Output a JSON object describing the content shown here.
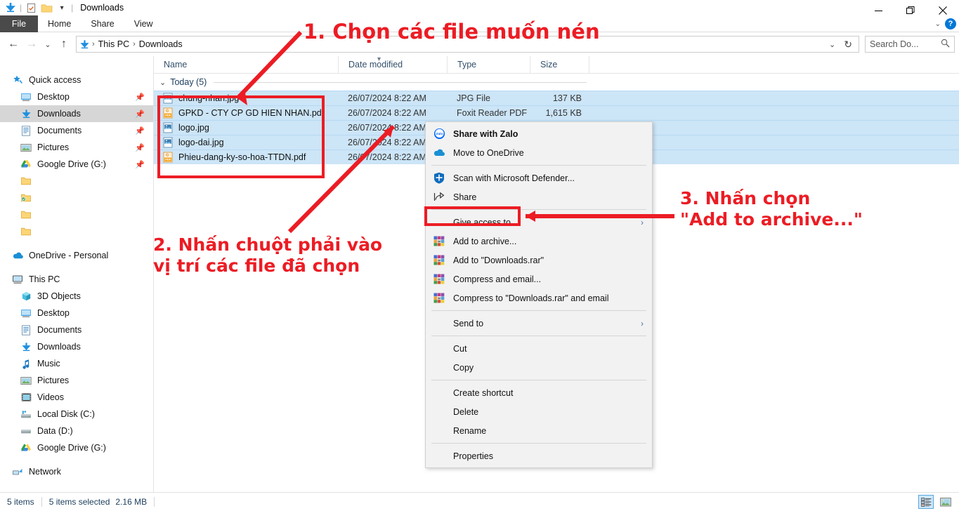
{
  "window": {
    "title": "Downloads",
    "quick_access_icons": [
      "downloads-arrow-icon",
      "properties-icon",
      "folder-icon",
      "chevron-down-icon"
    ],
    "minimize": "—",
    "maximize": "❐",
    "close": "✕"
  },
  "ribbon": {
    "tabs": [
      {
        "label": "File",
        "active": true
      },
      {
        "label": "Home",
        "active": false
      },
      {
        "label": "Share",
        "active": false
      },
      {
        "label": "View",
        "active": false
      }
    ],
    "collapse_chevron": "⌄",
    "help_label": "?"
  },
  "address": {
    "back": "←",
    "forward": "→",
    "recent": "⌄",
    "up": "↑",
    "breadcrumbs": [
      "This PC",
      "Downloads"
    ],
    "separator": "›",
    "dropdown": "⌄",
    "refresh": "↻",
    "search_placeholder": "Search Do...",
    "search_value": "",
    "search_icon": "search-icon"
  },
  "sidebar": {
    "quick_access": {
      "label": "Quick access",
      "icon": "star-pin-icon",
      "items": [
        {
          "label": "Desktop",
          "icon": "desktop-icon",
          "pinned": true,
          "selected": false
        },
        {
          "label": "Downloads",
          "icon": "downloads-arrow-icon",
          "pinned": true,
          "selected": true
        },
        {
          "label": "Documents",
          "icon": "documents-icon",
          "pinned": true,
          "selected": false
        },
        {
          "label": "Pictures",
          "icon": "pictures-icon",
          "pinned": true,
          "selected": false
        },
        {
          "label": "Google Drive (G:)",
          "icon": "google-drive-icon",
          "pinned": true,
          "selected": false
        },
        {
          "label": "",
          "icon": "folder-icon",
          "pinned": false,
          "selected": false
        },
        {
          "label": "",
          "icon": "folder-synced-icon",
          "pinned": false,
          "selected": false
        },
        {
          "label": "",
          "icon": "folder-icon",
          "pinned": false,
          "selected": false
        },
        {
          "label": "",
          "icon": "folder-icon",
          "pinned": false,
          "selected": false
        }
      ]
    },
    "onedrive": {
      "label": "OneDrive - Personal",
      "icon": "onedrive-cloud-icon"
    },
    "this_pc": {
      "label": "This PC",
      "icon": "this-pc-icon",
      "items": [
        {
          "label": "3D Objects",
          "icon": "3d-objects-icon"
        },
        {
          "label": "Desktop",
          "icon": "desktop-icon"
        },
        {
          "label": "Documents",
          "icon": "documents-icon"
        },
        {
          "label": "Downloads",
          "icon": "downloads-arrow-icon"
        },
        {
          "label": "Music",
          "icon": "music-note-icon"
        },
        {
          "label": "Pictures",
          "icon": "pictures-icon"
        },
        {
          "label": "Videos",
          "icon": "videos-icon"
        },
        {
          "label": "Local Disk (C:)",
          "icon": "hard-drive-icon"
        },
        {
          "label": "Data (D:)",
          "icon": "hard-drive-icon"
        },
        {
          "label": "Google Drive (G:)",
          "icon": "google-drive-icon"
        }
      ]
    },
    "network": {
      "label": "Network",
      "icon": "network-icon"
    }
  },
  "file_list": {
    "columns": [
      {
        "key": "name",
        "label": "Name"
      },
      {
        "key": "date",
        "label": "Date modified"
      },
      {
        "key": "type",
        "label": "Type"
      },
      {
        "key": "size",
        "label": "Size"
      }
    ],
    "sort_column": "Date modified",
    "sort_direction": "descending",
    "groups": [
      {
        "label": "Today (5)",
        "expanded": true,
        "chevron": "⌄",
        "rows": [
          {
            "name": "chung-nhan.jpg",
            "date": "26/07/2024 8:22 AM",
            "type": "JPG File",
            "size": "137 KB",
            "icon": "jpg-file-icon",
            "selected": true
          },
          {
            "name": "GPKD - CTY CP GD HIEN NHAN.pdf",
            "date": "26/07/2024 8:22 AM",
            "type": "Foxit Reader PDF",
            "size": "1,615 KB",
            "icon": "pdf-file-icon",
            "selected": true
          },
          {
            "name": "logo.jpg",
            "date": "26/07/2024 8:22 AM",
            "type": "",
            "size": "",
            "icon": "jpg-file-icon",
            "selected": true
          },
          {
            "name": "logo-dai.jpg",
            "date": "26/07/2024 8:22 AM",
            "type": "",
            "size": "",
            "icon": "jpg-file-icon",
            "selected": true
          },
          {
            "name": "Phieu-dang-ky-so-hoa-TTDN.pdf",
            "date": "26/07/2024 8:22 AM",
            "type": "",
            "size": "",
            "icon": "pdf-file-icon",
            "selected": true
          }
        ]
      }
    ]
  },
  "context_menu": {
    "items": [
      {
        "label": "Share with Zalo",
        "icon": "zalo-icon",
        "bold": true,
        "separator_after": false,
        "submenu": false,
        "highlighted": false
      },
      {
        "label": "Move to OneDrive",
        "icon": "onedrive-cloud-icon",
        "bold": false,
        "separator_after": true,
        "submenu": false,
        "highlighted": false
      },
      {
        "label": "Scan with Microsoft Defender...",
        "icon": "defender-shield-icon",
        "bold": false,
        "separator_after": false,
        "submenu": false,
        "highlighted": false
      },
      {
        "label": "Share",
        "icon": "share-icon",
        "bold": false,
        "separator_after": true,
        "submenu": false,
        "highlighted": false
      },
      {
        "label": "Give access to",
        "icon": "",
        "bold": false,
        "separator_after": false,
        "submenu": true,
        "highlighted": false
      },
      {
        "label": "Add to archive...",
        "icon": "winrar-icon",
        "bold": false,
        "separator_after": false,
        "submenu": false,
        "highlighted": true
      },
      {
        "label": "Add to \"Downloads.rar\"",
        "icon": "winrar-icon",
        "bold": false,
        "separator_after": false,
        "submenu": false,
        "highlighted": false
      },
      {
        "label": "Compress and email...",
        "icon": "winrar-icon",
        "bold": false,
        "separator_after": false,
        "submenu": false,
        "highlighted": false
      },
      {
        "label": "Compress to \"Downloads.rar\" and email",
        "icon": "winrar-icon",
        "bold": false,
        "separator_after": true,
        "submenu": false,
        "highlighted": false
      },
      {
        "label": "Send to",
        "icon": "",
        "bold": false,
        "separator_after": true,
        "submenu": true,
        "highlighted": false
      },
      {
        "label": "Cut",
        "icon": "",
        "bold": false,
        "separator_after": false,
        "submenu": false,
        "highlighted": false
      },
      {
        "label": "Copy",
        "icon": "",
        "bold": false,
        "separator_after": true,
        "submenu": false,
        "highlighted": false
      },
      {
        "label": "Create shortcut",
        "icon": "",
        "bold": false,
        "separator_after": false,
        "submenu": false,
        "highlighted": false
      },
      {
        "label": "Delete",
        "icon": "",
        "bold": false,
        "separator_after": false,
        "submenu": false,
        "highlighted": false
      },
      {
        "label": "Rename",
        "icon": "",
        "bold": false,
        "separator_after": true,
        "submenu": false,
        "highlighted": false
      },
      {
        "label": "Properties",
        "icon": "",
        "bold": false,
        "separator_after": false,
        "submenu": false,
        "highlighted": false
      }
    ],
    "submenu_arrow": "›"
  },
  "status_bar": {
    "item_count": "5 items",
    "selection": "5 items selected",
    "selection_size": "2.16 MB",
    "views": [
      {
        "name": "details-view",
        "active": true
      },
      {
        "name": "large-icons-view",
        "active": false
      }
    ]
  },
  "annotations": {
    "step1": "1. Chọn các file muốn nén",
    "step2": "2. Nhấn chuột phải vào\nvị trí các file đã chọn",
    "step3": "3. Nhấn chọn\n\"Add to archive...\"",
    "color": "#ec1c24"
  }
}
